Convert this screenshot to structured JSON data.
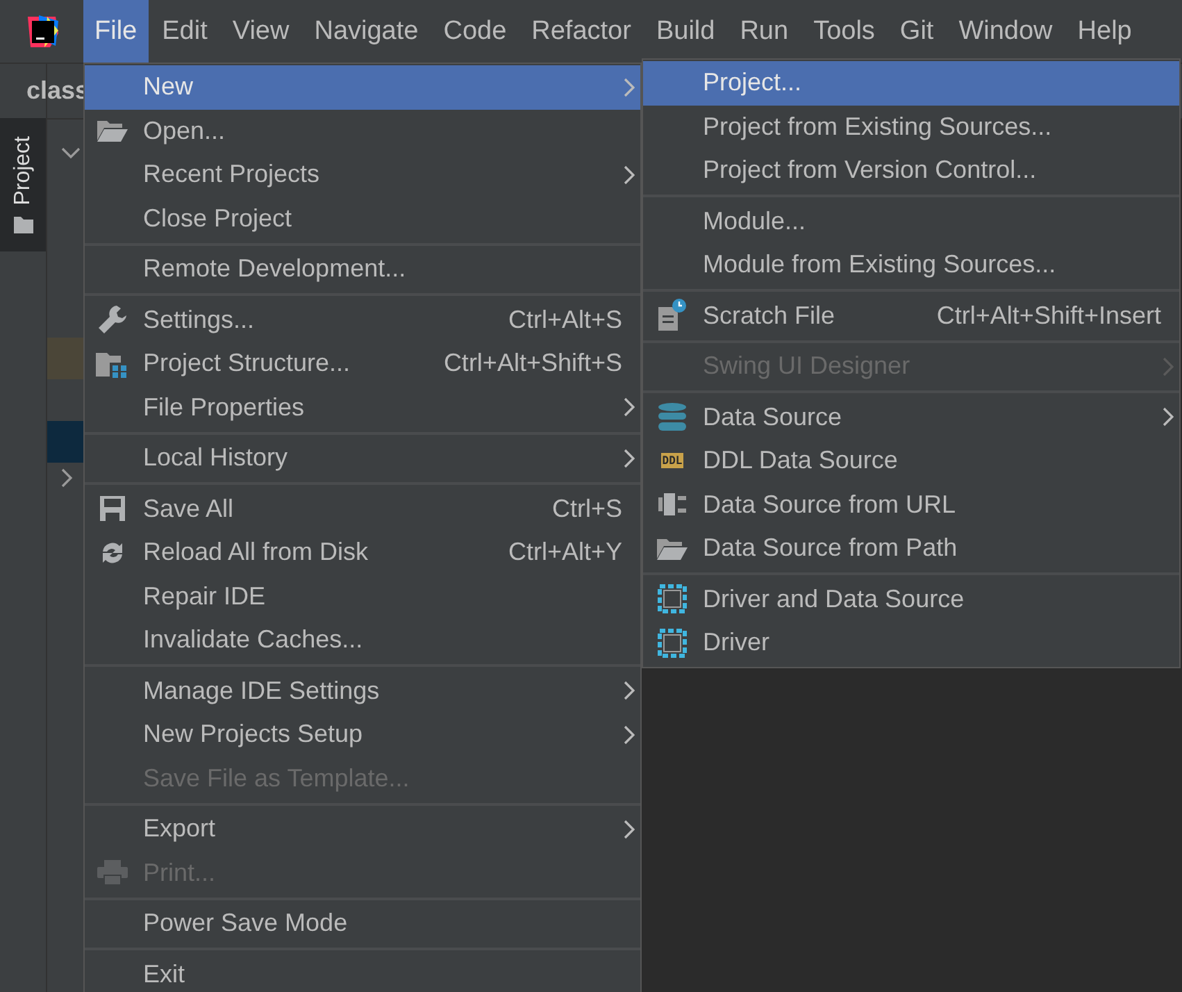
{
  "menubar": [
    {
      "label": "File",
      "selected": true
    },
    {
      "label": "Edit",
      "selected": false
    },
    {
      "label": "View",
      "selected": false
    },
    {
      "label": "Navigate",
      "selected": false
    },
    {
      "label": "Code",
      "selected": false
    },
    {
      "label": "Refactor",
      "selected": false
    },
    {
      "label": "Build",
      "selected": false
    },
    {
      "label": "Run",
      "selected": false
    },
    {
      "label": "Tools",
      "selected": false
    },
    {
      "label": "Git",
      "selected": false
    },
    {
      "label": "Window",
      "selected": false
    },
    {
      "label": "Help",
      "selected": false
    }
  ],
  "editor_tab": {
    "label": "class"
  },
  "tool_window_tab": {
    "label": "Project",
    "selected": true
  },
  "file_menu": [
    {
      "kind": "item",
      "label": "New",
      "selected": true,
      "disabled": false,
      "submenu": true
    },
    {
      "kind": "item",
      "label": "Open...",
      "selected": false,
      "disabled": false,
      "submenu": false
    },
    {
      "kind": "item",
      "label": "Recent Projects",
      "selected": false,
      "disabled": false,
      "submenu": true
    },
    {
      "kind": "item",
      "label": "Close Project",
      "selected": false,
      "disabled": false,
      "submenu": false
    },
    {
      "kind": "separator"
    },
    {
      "kind": "item",
      "label": "Remote Development...",
      "selected": false,
      "disabled": false,
      "submenu": false
    },
    {
      "kind": "separator"
    },
    {
      "kind": "item",
      "label": "Settings...",
      "shortcut": "Ctrl+Alt+S",
      "selected": false,
      "disabled": false,
      "submenu": false
    },
    {
      "kind": "item",
      "label": "Project Structure...",
      "shortcut": "Ctrl+Alt+Shift+S",
      "selected": false,
      "disabled": false,
      "submenu": false
    },
    {
      "kind": "item",
      "label": "File Properties",
      "selected": false,
      "disabled": false,
      "submenu": true
    },
    {
      "kind": "separator"
    },
    {
      "kind": "item",
      "label": "Local History",
      "selected": false,
      "disabled": false,
      "submenu": true
    },
    {
      "kind": "separator"
    },
    {
      "kind": "item",
      "label": "Save All",
      "shortcut": "Ctrl+S",
      "selected": false,
      "disabled": false,
      "submenu": false
    },
    {
      "kind": "item",
      "label": "Reload All from Disk",
      "shortcut": "Ctrl+Alt+Y",
      "selected": false,
      "disabled": false,
      "submenu": false
    },
    {
      "kind": "item",
      "label": "Repair IDE",
      "selected": false,
      "disabled": false,
      "submenu": false
    },
    {
      "kind": "item",
      "label": "Invalidate Caches...",
      "selected": false,
      "disabled": false,
      "submenu": false
    },
    {
      "kind": "separator"
    },
    {
      "kind": "item",
      "label": "Manage IDE Settings",
      "selected": false,
      "disabled": false,
      "submenu": true
    },
    {
      "kind": "item",
      "label": "New Projects Setup",
      "selected": false,
      "disabled": false,
      "submenu": true
    },
    {
      "kind": "item",
      "label": "Save File as Template...",
      "selected": false,
      "disabled": true,
      "submenu": false
    },
    {
      "kind": "separator"
    },
    {
      "kind": "item",
      "label": "Export",
      "selected": false,
      "disabled": false,
      "submenu": true
    },
    {
      "kind": "item",
      "label": "Print...",
      "selected": false,
      "disabled": true,
      "submenu": false
    },
    {
      "kind": "separator"
    },
    {
      "kind": "item",
      "label": "Power Save Mode",
      "selected": false,
      "disabled": false,
      "submenu": false
    },
    {
      "kind": "separator"
    },
    {
      "kind": "item",
      "label": "Exit",
      "selected": false,
      "disabled": false,
      "submenu": false
    }
  ],
  "new_submenu": [
    {
      "kind": "item",
      "label": "Project...",
      "selected": true,
      "disabled": false,
      "submenu": false
    },
    {
      "kind": "item",
      "label": "Project from Existing Sources...",
      "selected": false,
      "disabled": false,
      "submenu": false
    },
    {
      "kind": "item",
      "label": "Project from Version Control...",
      "selected": false,
      "disabled": false,
      "submenu": false
    },
    {
      "kind": "separator"
    },
    {
      "kind": "item",
      "label": "Module...",
      "selected": false,
      "disabled": false,
      "submenu": false
    },
    {
      "kind": "item",
      "label": "Module from Existing Sources...",
      "selected": false,
      "disabled": false,
      "submenu": false
    },
    {
      "kind": "separator"
    },
    {
      "kind": "item",
      "label": "Scratch File",
      "shortcut": "Ctrl+Alt+Shift+Insert",
      "selected": false,
      "disabled": false,
      "submenu": false
    },
    {
      "kind": "separator"
    },
    {
      "kind": "item",
      "label": "Swing UI Designer",
      "selected": false,
      "disabled": true,
      "submenu": true
    },
    {
      "kind": "separator"
    },
    {
      "kind": "item",
      "label": "Data Source",
      "selected": false,
      "disabled": false,
      "submenu": true
    },
    {
      "kind": "item",
      "label": "DDL Data Source",
      "icon_text": "DDL",
      "selected": false,
      "disabled": false,
      "submenu": false
    },
    {
      "kind": "item",
      "label": "Data Source from URL",
      "selected": false,
      "disabled": false,
      "submenu": false
    },
    {
      "kind": "item",
      "label": "Data Source from Path",
      "selected": false,
      "disabled": false,
      "submenu": false
    },
    {
      "kind": "separator"
    },
    {
      "kind": "item",
      "label": "Driver and Data Source",
      "selected": false,
      "disabled": false,
      "submenu": false
    },
    {
      "kind": "item",
      "label": "Driver",
      "selected": false,
      "disabled": false,
      "submenu": false
    }
  ]
}
